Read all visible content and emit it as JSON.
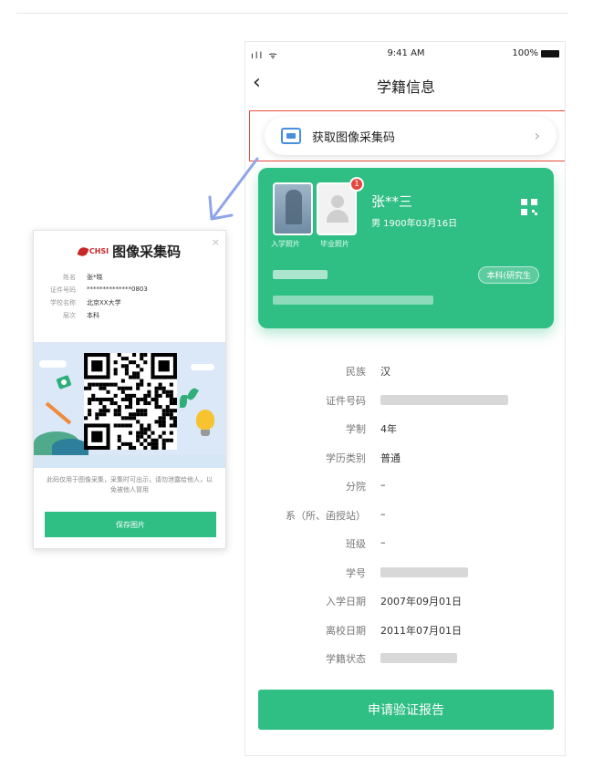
{
  "phone": {
    "status": {
      "signal": "ıll ᯤ",
      "time": "9:41 AM",
      "battery": "100%"
    },
    "nav": {
      "back": "‹",
      "title": "学籍信息"
    },
    "fetch": {
      "label": "获取图像采集码",
      "arrow": "›"
    },
    "card": {
      "badge": "1",
      "enroll_photo_label": "入学照片",
      "grad_photo_label": "毕业照片",
      "name": "张**三",
      "birth": "男  1900年03月16日",
      "degree": "本科(研究生"
    },
    "info": [
      {
        "label": "民族",
        "value": "汉"
      },
      {
        "label": "证件号码",
        "value": ""
      },
      {
        "label": "学制",
        "value": "4年"
      },
      {
        "label": "学历类别",
        "value": "普通"
      },
      {
        "label": "分院",
        "value": "–"
      },
      {
        "label": "系（所、函授站）",
        "value": "–"
      },
      {
        "label": "班级",
        "value": "–"
      },
      {
        "label": "学号",
        "value": ""
      },
      {
        "label": "入学日期",
        "value": "2007年09月01日"
      },
      {
        "label": "离校日期",
        "value": "2011年07月01日"
      },
      {
        "label": "学籍状态",
        "value": ""
      }
    ],
    "report_button": "申请验证报告"
  },
  "popup": {
    "logo_text": "CHSI",
    "title": "图像采集码",
    "close": "×",
    "fields": [
      {
        "label": "姓名",
        "value": "张*晓"
      },
      {
        "label": "证件号码",
        "value": "**************0803"
      },
      {
        "label": "学校名称",
        "value": "北京XX大学"
      },
      {
        "label": "层次",
        "value": "本科"
      }
    ],
    "description": "此码仅用于图像采集，采集时可出示，请勿泄露给他人，以免被他人冒用",
    "save_button": "保存图片"
  },
  "colors": {
    "accent": "#2fbe83",
    "highlight": "#e74c3c",
    "arrow": "#8ea6e8"
  }
}
